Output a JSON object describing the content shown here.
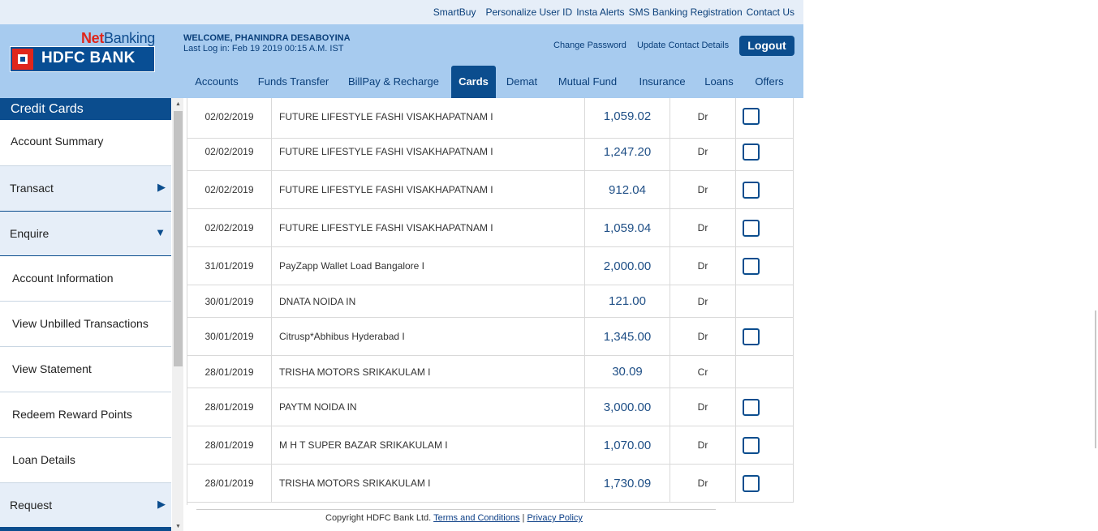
{
  "util_links": [
    "SmartBuy",
    "Personalize User ID",
    "Insta Alerts",
    "SMS Banking Registration",
    "Contact Us"
  ],
  "logo": {
    "net": "Net",
    "banking": "Banking",
    "bank_name": "HDFC BANK"
  },
  "welcome": {
    "line1": "WELCOME, PHANINDRA DESABOYINA",
    "line2": "Last Log in: Feb 19 2019 00:15 A.M. IST"
  },
  "account_links": {
    "change_password": "Change Password",
    "update_contact": "Update Contact Details"
  },
  "logout_label": "Logout",
  "nav_tabs": [
    "Accounts",
    "Funds Transfer",
    "BillPay & Recharge",
    "Cards",
    "Demat",
    "Mutual Fund",
    "Insurance",
    "Loans",
    "Offers"
  ],
  "active_tab": "Cards",
  "sidebar": {
    "title": "Credit Cards",
    "items": [
      {
        "label": "Account Summary",
        "section": false,
        "arrow": ""
      },
      {
        "label": "Transact",
        "section": true,
        "arrow": "▶"
      },
      {
        "label": "Enquire",
        "section": true,
        "arrow": "▼"
      },
      {
        "label": "Account Information",
        "section": false,
        "arrow": ""
      },
      {
        "label": "View Unbilled Transactions",
        "section": false,
        "arrow": ""
      },
      {
        "label": "View Statement",
        "section": false,
        "arrow": ""
      },
      {
        "label": "Redeem Reward Points",
        "section": false,
        "arrow": ""
      },
      {
        "label": "Loan Details",
        "section": false,
        "arrow": ""
      },
      {
        "label": "Request",
        "section": true,
        "arrow": "▶"
      }
    ]
  },
  "transactions": [
    {
      "date": "02/02/2019",
      "desc": "FUTURE LIFESTYLE FASHI VISAKHAPATNAM I",
      "amount": "1,059.02",
      "type": "Dr",
      "checkbox": true
    },
    {
      "date": "02/02/2019",
      "desc": "FUTURE LIFESTYLE FASHI VISAKHAPATNAM I",
      "amount": "1,247.20",
      "type": "Dr",
      "checkbox": true
    },
    {
      "date": "02/02/2019",
      "desc": "FUTURE LIFESTYLE FASHI VISAKHAPATNAM I",
      "amount": "912.04",
      "type": "Dr",
      "checkbox": true
    },
    {
      "date": "02/02/2019",
      "desc": "FUTURE LIFESTYLE FASHI VISAKHAPATNAM I",
      "amount": "1,059.04",
      "type": "Dr",
      "checkbox": true
    },
    {
      "date": "31/01/2019",
      "desc": "PayZapp Wallet Load Bangalore I",
      "amount": "2,000.00",
      "type": "Dr",
      "checkbox": true
    },
    {
      "date": "30/01/2019",
      "desc": "DNATA NOIDA IN",
      "amount": "121.00",
      "type": "Dr",
      "checkbox": false
    },
    {
      "date": "30/01/2019",
      "desc": "Citrusp*Abhibus Hyderabad I",
      "amount": "1,345.00",
      "type": "Dr",
      "checkbox": true
    },
    {
      "date": "28/01/2019",
      "desc": "TRISHA MOTORS SRIKAKULAM I",
      "amount": "30.09",
      "type": "Cr",
      "checkbox": false
    },
    {
      "date": "28/01/2019",
      "desc": "PAYTM NOIDA IN",
      "amount": "3,000.00",
      "type": "Dr",
      "checkbox": true
    },
    {
      "date": "28/01/2019",
      "desc": "M H T SUPER BAZAR SRIKAKULAM I",
      "amount": "1,070.00",
      "type": "Dr",
      "checkbox": true
    },
    {
      "date": "28/01/2019",
      "desc": "TRISHA MOTORS SRIKAKULAM I",
      "amount": "1,730.09",
      "type": "Dr",
      "checkbox": true
    }
  ],
  "footer": {
    "copyright": "Copyright HDFC Bank Ltd.",
    "terms": "Terms and Conditions",
    "sep": "|",
    "privacy": "Privacy Policy"
  }
}
